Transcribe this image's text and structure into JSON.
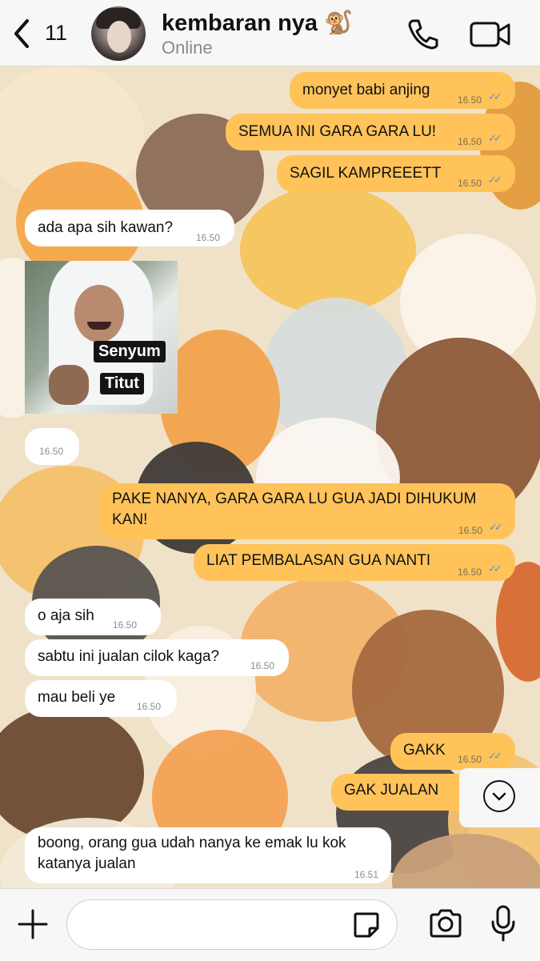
{
  "header": {
    "back_count": "11",
    "contact_name": "kembaran nya 🐒",
    "status": "Online"
  },
  "messages": [
    {
      "dir": "out",
      "text": "monyet babi anjing",
      "time": "16.50"
    },
    {
      "dir": "out",
      "text": "SEMUA INI GARA GARA LU!",
      "time": "16.50"
    },
    {
      "dir": "out",
      "text": "SAGIL KAMPREEETT",
      "time": "16.50"
    },
    {
      "dir": "in",
      "text": "ada apa sih kawan?",
      "time": "16.50"
    },
    {
      "dir": "in",
      "type": "sticker",
      "sticker_lines": [
        "Senyum",
        "Titut"
      ],
      "time": "16.50"
    },
    {
      "dir": "out",
      "text_line1": "PAKE NANYA, GARA GARA LU GUA JADI DIHUKUM",
      "text_line2": "KAN!",
      "time": "16.50"
    },
    {
      "dir": "out",
      "text": "LIAT PEMBALASAN GUA NANTI",
      "time": "16.50"
    },
    {
      "dir": "in",
      "text": "o aja sih",
      "time": "16.50"
    },
    {
      "dir": "in",
      "text": "sabtu ini jualan cilok kaga?",
      "time": "16.50"
    },
    {
      "dir": "in",
      "text": "mau beli ye",
      "time": "16.50"
    },
    {
      "dir": "out",
      "text": "GAKK",
      "time": "16.50"
    },
    {
      "dir": "out",
      "text": "GAK JUALAN",
      "time": ""
    },
    {
      "dir": "in",
      "text_line1": "boong, orang gua udah nanya ke emak lu kok",
      "text_line2": "katanya jualan",
      "time": "16.51"
    }
  ],
  "colors": {
    "outgoing_bubble": "#ffc35a",
    "incoming_bubble": "#ffffff",
    "read_ticks": "#5a8fd6"
  },
  "icons": {
    "back": "chevron-left-icon",
    "call": "phone-icon",
    "video": "video-camera-icon",
    "scroll_down": "chevron-down-circle-icon",
    "add": "plus-icon",
    "sticker": "sticker-icon",
    "camera": "camera-icon",
    "mic": "microphone-icon"
  }
}
